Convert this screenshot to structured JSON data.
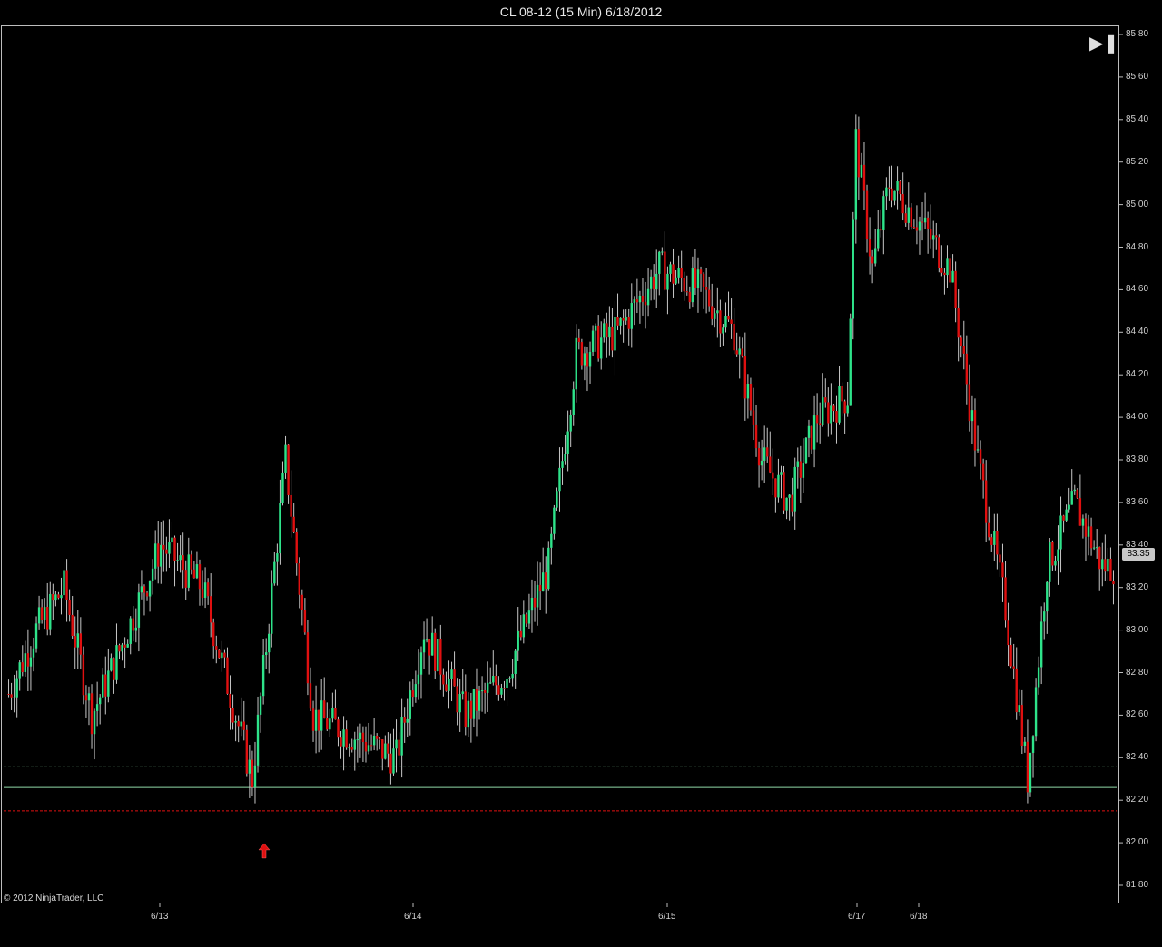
{
  "title": "CL 08-12 (15 Min)  6/18/2012",
  "copyright": "© 2012 NinjaTrader, LLC",
  "current_price": "83.35",
  "colors": {
    "up": "#2ee38a",
    "down": "#e01010",
    "wick": "#c8c8c8",
    "grid": "#000000",
    "line_green": "#8fd9a8",
    "line_red": "#e01010",
    "background": "#000000"
  },
  "chart_data": {
    "type": "candlestick",
    "ylim": [
      81.7,
      85.85
    ],
    "yticks": [
      "85.80",
      "85.60",
      "85.40",
      "85.20",
      "85.00",
      "84.80",
      "84.60",
      "84.40",
      "84.20",
      "84.00",
      "83.80",
      "83.60",
      "83.40",
      "83.20",
      "83.00",
      "82.80",
      "82.60",
      "82.40",
      "82.20",
      "82.00",
      "81.80"
    ],
    "xticks": [
      "6/13",
      "6/14",
      "6/15",
      "6/17",
      "6/18"
    ],
    "horizontal_lines": [
      {
        "value": 82.36,
        "style": "dashed",
        "color": "green"
      },
      {
        "value": 82.26,
        "style": "solid",
        "color": "green"
      },
      {
        "value": 82.15,
        "style": "dashed",
        "color": "red"
      }
    ],
    "arrow_marker": {
      "direction": "up",
      "near": "6/13 session low",
      "value": 82.15
    },
    "price_series": [
      {
        "bar": 0,
        "close": 82.7
      },
      {
        "bar": 10,
        "close": 83.0
      },
      {
        "bar": 20,
        "close": 83.2
      },
      {
        "bar": 30,
        "close": 82.6
      },
      {
        "bar": 40,
        "close": 82.9
      },
      {
        "bar": 55,
        "close": 83.4
      },
      {
        "bar": 70,
        "close": 83.2
      },
      {
        "bar": 88,
        "close": 82.3
      },
      {
        "bar": 100,
        "close": 83.8
      },
      {
        "bar": 110,
        "close": 82.6
      },
      {
        "bar": 125,
        "close": 82.5
      },
      {
        "bar": 140,
        "close": 82.4
      },
      {
        "bar": 150,
        "close": 83.0
      },
      {
        "bar": 165,
        "close": 82.6
      },
      {
        "bar": 180,
        "close": 82.8
      },
      {
        "bar": 195,
        "close": 83.3
      },
      {
        "bar": 205,
        "close": 84.3
      },
      {
        "bar": 220,
        "close": 84.4
      },
      {
        "bar": 235,
        "close": 84.7
      },
      {
        "bar": 250,
        "close": 84.6
      },
      {
        "bar": 262,
        "close": 84.4
      },
      {
        "bar": 272,
        "close": 83.8
      },
      {
        "bar": 282,
        "close": 83.6
      },
      {
        "bar": 292,
        "close": 84.0
      },
      {
        "bar": 303,
        "close": 84.1
      },
      {
        "bar": 306,
        "close": 85.3
      },
      {
        "bar": 312,
        "close": 84.7
      },
      {
        "bar": 318,
        "close": 85.1
      },
      {
        "bar": 330,
        "close": 84.9
      },
      {
        "bar": 340,
        "close": 84.7
      },
      {
        "bar": 350,
        "close": 83.8
      },
      {
        "bar": 360,
        "close": 83.1
      },
      {
        "bar": 368,
        "close": 82.3
      },
      {
        "bar": 375,
        "close": 83.3
      },
      {
        "bar": 385,
        "close": 83.6
      },
      {
        "bar": 395,
        "close": 83.3
      }
    ]
  }
}
